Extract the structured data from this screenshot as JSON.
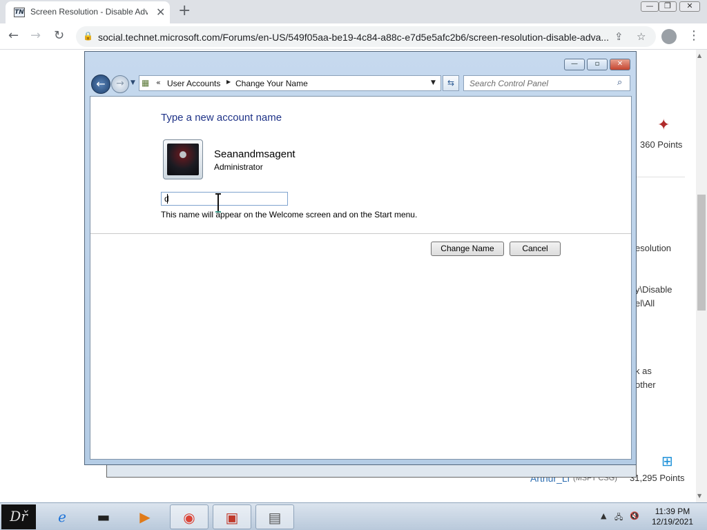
{
  "browser": {
    "tab": {
      "favicon": "TN",
      "title": "Screen Resolution - Disable Adva",
      "close": "✕"
    },
    "new_tab": "+",
    "url": "social.technet.microsoft.com/Forums/en-US/549f05aa-be19-4c84-a88c-e7d5e5afc2b6/screen-resolution-disable-adva...",
    "window_controls": [
      "—",
      "❐",
      "✕"
    ]
  },
  "background_page": {
    "points_1": "360 Points",
    "fragment_resolution": "esolution",
    "fragment_disable": "y\\Disable",
    "fragment_all": "el\\All",
    "fragment_as": "k as",
    "fragment_other": "other",
    "user_2": "Arthur_Li",
    "user_2_org": "(MSFT CSG)",
    "points_2": "31,295 Points"
  },
  "control_panel": {
    "breadcrumb": [
      "User Accounts",
      "Change Your Name"
    ],
    "breadcrumb_prefix": "«",
    "search_placeholder": "Search Control Panel",
    "heading": "Type a new account name",
    "account_name": "Seanandmsagent",
    "account_role": "Administrator",
    "new_name_value": "d",
    "hint": "This name will appear on the Welcome screen and on the Start menu.",
    "change_button": "Change Name",
    "cancel_button": "Cancel"
  },
  "taskbar": {
    "start_label": "Dř",
    "time": "11:39 PM",
    "date": "12/19/2021"
  },
  "colors": {
    "accent_heading": "#1e3287",
    "window_frame": "#b4cce5",
    "link": "#2d5b94"
  }
}
